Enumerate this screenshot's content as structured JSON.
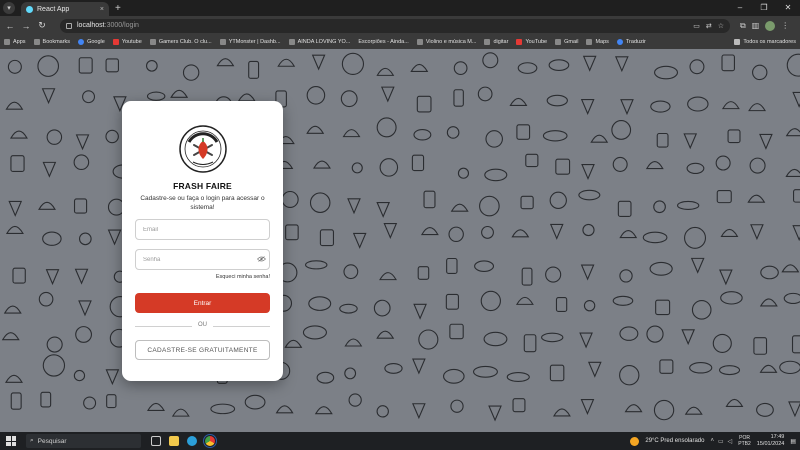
{
  "browser": {
    "tab_title": "React App",
    "tab_close": "×",
    "new_tab": "+",
    "url_host": "localhost",
    "url_path": ":3000/login",
    "back_icon": "arrow-left-icon",
    "forward_icon": "arrow-right-icon",
    "reload_icon": "reload-icon",
    "window_controls": [
      "–",
      "❐",
      "✕"
    ]
  },
  "bookmarks": [
    {
      "label": "Apps",
      "icon": "apps-icon"
    },
    {
      "label": "Bookmarks",
      "icon": "star-icon"
    },
    {
      "label": "Google",
      "icon": "google-icon"
    },
    {
      "label": "Youtube",
      "icon": "youtube-icon"
    },
    {
      "label": "Gamers Club. O clu...",
      "icon": "gamersclub-icon"
    },
    {
      "label": "YTMonster | Dashb...",
      "icon": "ytmonster-icon"
    },
    {
      "label": "AINDA LOVING YO...",
      "icon": "github-icon"
    },
    {
      "label": "Escorpiões - Ainda...",
      "icon": "page-icon"
    },
    {
      "label": "Violino e música M...",
      "icon": "page-icon"
    },
    {
      "label": "digitar",
      "icon": "page-icon"
    },
    {
      "label": "YouTube",
      "icon": "youtube-icon"
    },
    {
      "label": "Gmail",
      "icon": "gmail-icon"
    },
    {
      "label": "Maps",
      "icon": "maps-icon"
    },
    {
      "label": "Traduzir",
      "icon": "translate-icon"
    }
  ],
  "bookmarks_all": "Todos os marcadores",
  "login": {
    "brand": "FRASH FAIRE",
    "logo_text": "FRESH FAIRE",
    "subtitle": "Cadastre-se ou faça o login para acessar o sistema!",
    "email_placeholder": "Email",
    "password_placeholder": "Senha",
    "forgot": "Esqueci minha senha!",
    "login_button": "Entrar",
    "or": "OU",
    "register_button": "CADASTRE-SE GRATUITAMENTE"
  },
  "taskbar": {
    "search_placeholder": "Pesquisar",
    "weather": "29°C  Pred ensolarado",
    "lang_top": "POR",
    "lang_bottom": "PTB2",
    "time": "17:49",
    "date": "15/01/2024"
  },
  "colors": {
    "accent": "#d53a26",
    "page_bg": "#7c8087",
    "card": "#ffffff"
  }
}
